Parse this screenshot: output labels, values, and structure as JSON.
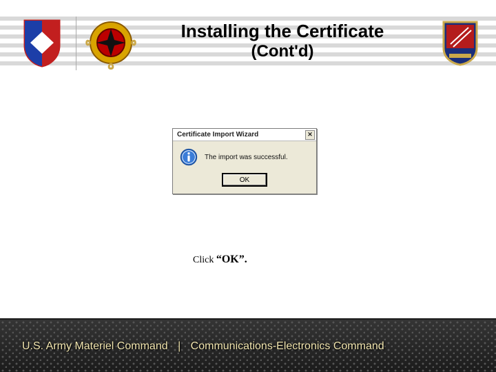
{
  "header": {
    "title_line1": "Installing the Certificate",
    "title_line2": "(Cont'd)"
  },
  "dialog": {
    "title": "Certificate Import Wizard",
    "message": "The import was successful.",
    "ok_label": "OK",
    "close_glyph": "✕"
  },
  "instruction": {
    "click": "Click ",
    "ok_quoted": "“OK”."
  },
  "footer": {
    "left": "U.S. Army Materiel Command",
    "sep": "|",
    "right": "Communications-Electronics Command"
  },
  "icons": {
    "info": "info-icon",
    "close": "close-icon",
    "shield": "amc-shield-crest",
    "star_crest": "star-compass-crest",
    "rocket_crest": "rocket-unit-crest"
  }
}
